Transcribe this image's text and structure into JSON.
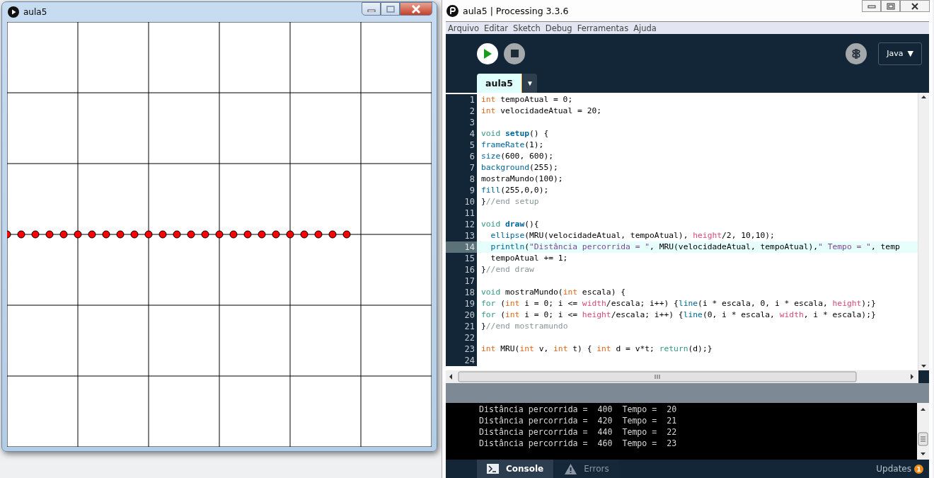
{
  "sketch_window": {
    "title": "aula5"
  },
  "ide": {
    "title": "aula5 | Processing 3.3.6",
    "menu": [
      "Arquivo",
      "Editar",
      "Sketch",
      "Debug",
      "Ferramentas",
      "Ajuda"
    ],
    "mode": {
      "label": "Java",
      "arrow": "▼"
    },
    "tabs": [
      {
        "label": "aula5",
        "selected": true
      }
    ],
    "tab_menu_arrow": "▼"
  },
  "editor": {
    "lines": [
      {
        "number": "1",
        "current": false,
        "tokens": [
          {
            "text": "int",
            "kind": "type"
          },
          {
            "text": " tempoAtual = 0;",
            "kind": "plain"
          }
        ]
      },
      {
        "number": "2",
        "current": false,
        "tokens": [
          {
            "text": "int",
            "kind": "type"
          },
          {
            "text": " velocidadeAtual = 20;",
            "kind": "plain"
          }
        ]
      },
      {
        "number": "3",
        "current": false
      },
      {
        "number": "4",
        "current": false,
        "tokens": [
          {
            "text": "void ",
            "kind": "keyword"
          },
          {
            "text": "setup",
            "kind": "definition"
          },
          {
            "text": "() {",
            "kind": "plain"
          }
        ]
      },
      {
        "number": "5",
        "current": false,
        "tokens": [
          {
            "text": "frameRate",
            "kind": "function"
          },
          {
            "text": "(1);",
            "kind": "plain"
          }
        ]
      },
      {
        "number": "6",
        "current": false,
        "tokens": [
          {
            "text": "size",
            "kind": "function"
          },
          {
            "text": "(600, 600);",
            "kind": "plain"
          }
        ]
      },
      {
        "number": "7",
        "current": false,
        "tokens": [
          {
            "text": "background",
            "kind": "function"
          },
          {
            "text": "(255);",
            "kind": "plain"
          }
        ]
      },
      {
        "number": "8",
        "current": false,
        "tokens": [
          {
            "text": "mostraMundo(100);",
            "kind": "plain"
          }
        ]
      },
      {
        "number": "9",
        "current": false,
        "tokens": [
          {
            "text": "fill",
            "kind": "function"
          },
          {
            "text": "(255,0,0);",
            "kind": "plain"
          }
        ]
      },
      {
        "number": "10",
        "current": false,
        "tokens": [
          {
            "text": "}",
            "kind": "plain"
          },
          {
            "text": "//end setup",
            "kind": "comment"
          }
        ]
      },
      {
        "number": "11",
        "current": false
      },
      {
        "number": "12",
        "current": false,
        "tokens": [
          {
            "text": "void ",
            "kind": "keyword"
          },
          {
            "text": "draw",
            "kind": "definition"
          },
          {
            "text": "(){",
            "kind": "plain"
          }
        ]
      },
      {
        "number": "13",
        "current": false,
        "indented": true,
        "tokens": [
          {
            "text": "ellipse",
            "kind": "function"
          },
          {
            "text": "(MRU(velocidadeAtual, tempoAtual), ",
            "kind": "plain"
          },
          {
            "text": "height",
            "kind": "variable"
          },
          {
            "text": "/2, 10,10);",
            "kind": "plain"
          }
        ]
      },
      {
        "number": "14",
        "current": true,
        "indented": true,
        "tokens": [
          {
            "text": "println",
            "kind": "function"
          },
          {
            "text": "(",
            "kind": "plain"
          },
          {
            "text": "\"Distância percorrida = \"",
            "kind": "string"
          },
          {
            "text": ", MRU(velocidadeAtual, tempoAtual),",
            "kind": "plain"
          },
          {
            "text": "\" Tempo = \"",
            "kind": "string"
          },
          {
            "text": ", temp",
            "kind": "plain"
          }
        ]
      },
      {
        "number": "15",
        "current": false,
        "indented": true,
        "tokens": [
          {
            "text": "tempoAtual += 1;",
            "kind": "plain"
          }
        ]
      },
      {
        "number": "16",
        "current": false,
        "tokens": [
          {
            "text": "}",
            "kind": "plain"
          },
          {
            "text": "//end draw",
            "kind": "comment"
          }
        ]
      },
      {
        "number": "17",
        "current": false
      },
      {
        "number": "18",
        "current": false,
        "tokens": [
          {
            "text": "void",
            "kind": "keyword"
          },
          {
            "text": " mostraMundo(",
            "kind": "plain"
          },
          {
            "text": "int",
            "kind": "type"
          },
          {
            "text": " escala) {",
            "kind": "plain"
          }
        ]
      },
      {
        "number": "19",
        "current": false,
        "tokens": [
          {
            "text": "for",
            "kind": "keyword"
          },
          {
            "text": " (",
            "kind": "plain"
          },
          {
            "text": "int",
            "kind": "type"
          },
          {
            "text": " i = 0; i <= ",
            "kind": "plain"
          },
          {
            "text": "width",
            "kind": "variable"
          },
          {
            "text": "/escala; i++) {",
            "kind": "plain"
          },
          {
            "text": "line",
            "kind": "function"
          },
          {
            "text": "(i * escala, 0, i * escala, ",
            "kind": "plain"
          },
          {
            "text": "height",
            "kind": "variable"
          },
          {
            "text": ");}",
            "kind": "plain"
          }
        ]
      },
      {
        "number": "20",
        "current": false,
        "tokens": [
          {
            "text": "for",
            "kind": "keyword"
          },
          {
            "text": " (",
            "kind": "plain"
          },
          {
            "text": "int",
            "kind": "type"
          },
          {
            "text": " i = 0; i <= ",
            "kind": "plain"
          },
          {
            "text": "height",
            "kind": "variable"
          },
          {
            "text": "/escala; i++) {",
            "kind": "plain"
          },
          {
            "text": "line",
            "kind": "function"
          },
          {
            "text": "(0, i * escala, ",
            "kind": "plain"
          },
          {
            "text": "width",
            "kind": "variable"
          },
          {
            "text": ", i * escala);}",
            "kind": "plain"
          }
        ]
      },
      {
        "number": "21",
        "current": false,
        "tokens": [
          {
            "text": "}",
            "kind": "plain"
          },
          {
            "text": "//end mostramundo",
            "kind": "comment"
          }
        ]
      },
      {
        "number": "22",
        "current": false
      },
      {
        "number": "23",
        "current": false,
        "tokens": [
          {
            "text": "int",
            "kind": "type"
          },
          {
            "text": " MRU(",
            "kind": "plain"
          },
          {
            "text": "int",
            "kind": "type"
          },
          {
            "text": " v, ",
            "kind": "plain"
          },
          {
            "text": "int",
            "kind": "type"
          },
          {
            "text": " t) { ",
            "kind": "plain"
          },
          {
            "text": "int",
            "kind": "type"
          },
          {
            "text": " d = v*t; ",
            "kind": "plain"
          },
          {
            "text": "return",
            "kind": "keyword"
          },
          {
            "text": "(d);}",
            "kind": "plain"
          }
        ]
      },
      {
        "number": "24",
        "current": false
      }
    ]
  },
  "console": {
    "lines": [
      "Distância percorrida =  400  Tempo =  20",
      "Distância percorrida =  420  Tempo =  21",
      "Distância percorrida =  440  Tempo =  22",
      "Distância percorrida =  460  Tempo =  23"
    ]
  },
  "footer": {
    "tabs": [
      {
        "label": "Console",
        "kind": "console",
        "selected": true
      },
      {
        "label": "Errors",
        "kind": "errors",
        "selected": false
      }
    ],
    "updates": {
      "label": "Updates",
      "count": "1"
    }
  }
}
